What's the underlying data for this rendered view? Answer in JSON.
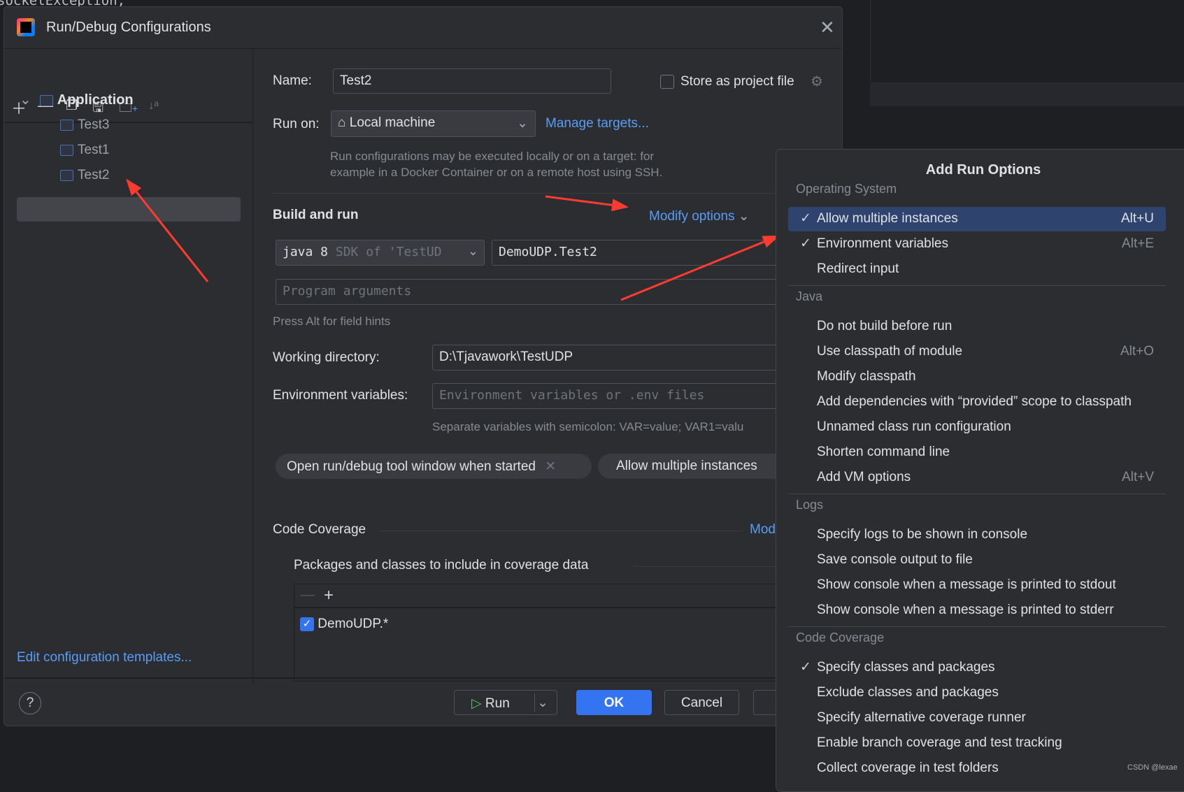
{
  "background": {
    "code_text": "socketException;"
  },
  "dialog": {
    "title": "Run/Debug Configurations",
    "toolbar": [
      "plus-icon",
      "minus-icon",
      "copy-icon",
      "save-icon",
      "new-folder-icon",
      "sort-icon"
    ],
    "tree": {
      "group": "Application",
      "items": [
        "Test3",
        "Test1",
        "Test2"
      ],
      "selected": "Test2"
    },
    "edit_templates": "Edit configuration templates...",
    "name_label": "Name:",
    "name_value": "Test2",
    "store_label": "Store as project file",
    "store_checked": false,
    "run_on_label": "Run on:",
    "run_on_value": "Local machine",
    "manage_targets": "Manage targets...",
    "run_on_hint1": "Run configurations may be executed locally or on a target: for",
    "run_on_hint2": "example in a Docker Container or on a remote host using SSH.",
    "build_title": "Build and run",
    "modify_options": "Modify options",
    "jdk_main": "java 8",
    "jdk_sub": "SDK of 'TestUD",
    "main_class": "DemoUDP.Test2",
    "program_args_placeholder": "Program arguments",
    "alt_hint": "Press Alt for field hints",
    "workdir_label": "Working directory:",
    "workdir_value": "D:\\Tjavawork\\TestUDP",
    "env_label": "Environment variables:",
    "env_placeholder": "Environment variables or .env files",
    "env_hint": "Separate variables with semicolon: VAR=value; VAR1=valu",
    "chips": [
      "Open run/debug tool window when started",
      "Allow multiple instances"
    ],
    "coverage_title": "Code Coverage",
    "coverage_link": "Mod",
    "packages_label": "Packages and classes to include in coverage data",
    "packages": [
      {
        "name": "DemoUDP.*",
        "checked": true
      }
    ],
    "buttons": {
      "run": "Run",
      "ok": "OK",
      "cancel": "Cancel"
    }
  },
  "popup": {
    "title": "Add Run Options",
    "sections": [
      {
        "title": "Operating System",
        "items": [
          {
            "label": "Allow multiple instances",
            "shortcut": "Alt+U",
            "checked": true,
            "highlighted": true
          },
          {
            "label": "Environment variables",
            "shortcut": "Alt+E",
            "checked": true
          },
          {
            "label": "Redirect input"
          }
        ]
      },
      {
        "title": "Java",
        "items": [
          {
            "label": "Do not build before run"
          },
          {
            "label": "Use classpath of module",
            "shortcut": "Alt+O"
          },
          {
            "label": "Modify classpath"
          },
          {
            "label": "Add dependencies with “provided” scope to classpath"
          },
          {
            "label": "Unnamed class run configuration"
          },
          {
            "label": "Shorten command line"
          },
          {
            "label": "Add VM options",
            "shortcut": "Alt+V"
          }
        ]
      },
      {
        "title": "Logs",
        "items": [
          {
            "label": "Specify logs to be shown in console"
          },
          {
            "label": "Save console output to file"
          },
          {
            "label": "Show console when a message is printed to stdout"
          },
          {
            "label": "Show console when a message is printed to stderr"
          }
        ]
      },
      {
        "title": "Code Coverage",
        "items": [
          {
            "label": "Specify classes and packages",
            "checked": true
          },
          {
            "label": "Exclude classes and packages"
          },
          {
            "label": "Specify alternative coverage runner"
          },
          {
            "label": "Enable branch coverage and test tracking"
          },
          {
            "label": "Collect coverage in test folders"
          }
        ]
      }
    ]
  },
  "colors": {
    "accent": "#3574f0",
    "link": "#589df6",
    "highlight": "#2e436e",
    "annotation_arrow": "#ff3b30"
  },
  "watermark": "CSDN @lexae"
}
